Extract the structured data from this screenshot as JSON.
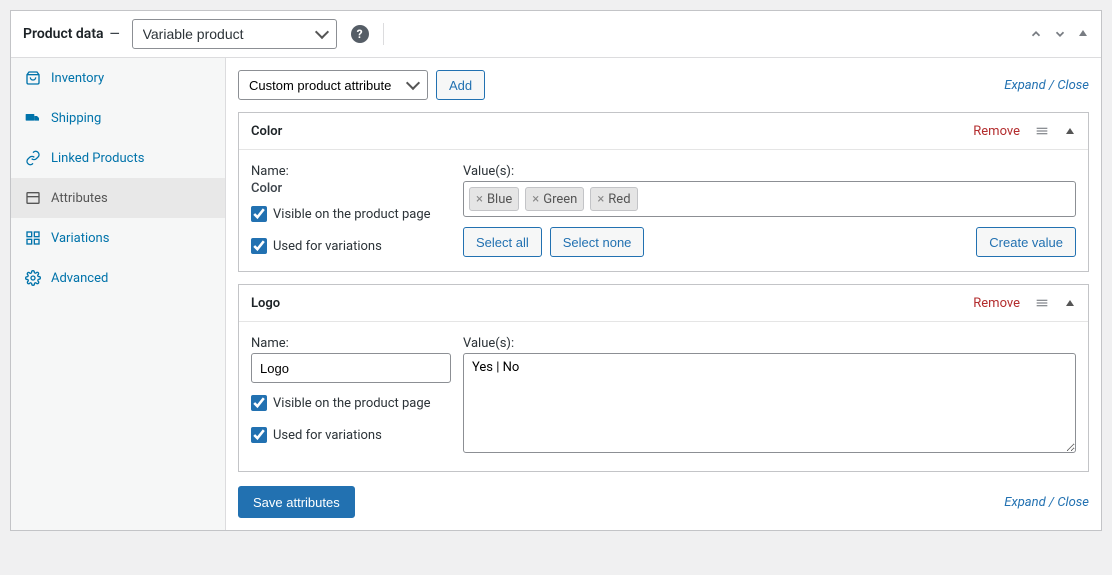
{
  "header": {
    "title": "Product data",
    "product_type": "Variable product"
  },
  "sidebar": {
    "items": [
      {
        "label": "Inventory"
      },
      {
        "label": "Shipping"
      },
      {
        "label": "Linked Products"
      },
      {
        "label": "Attributes"
      },
      {
        "label": "Variations"
      },
      {
        "label": "Advanced"
      }
    ]
  },
  "toolbar": {
    "attribute_select": "Custom product attribute",
    "add_label": "Add",
    "expand_close": "Expand / Close"
  },
  "attributes": [
    {
      "title": "Color",
      "name_label": "Name:",
      "name_value": "Color",
      "name_editable": false,
      "values_label": "Value(s):",
      "values_type": "tags",
      "values": [
        "Blue",
        "Green",
        "Red"
      ],
      "visible_label": "Visible on the product page",
      "visible": true,
      "variations_label": "Used for variations",
      "variations": true,
      "select_all": "Select all",
      "select_none": "Select none",
      "create_value": "Create value",
      "remove": "Remove"
    },
    {
      "title": "Logo",
      "name_label": "Name:",
      "name_value": "Logo",
      "name_editable": true,
      "values_label": "Value(s):",
      "values_type": "textarea",
      "values_text": "Yes | No",
      "visible_label": "Visible on the product page",
      "visible": true,
      "variations_label": "Used for variations",
      "variations": true,
      "remove": "Remove"
    }
  ],
  "footer": {
    "save_label": "Save attributes",
    "expand_close": "Expand / Close"
  }
}
